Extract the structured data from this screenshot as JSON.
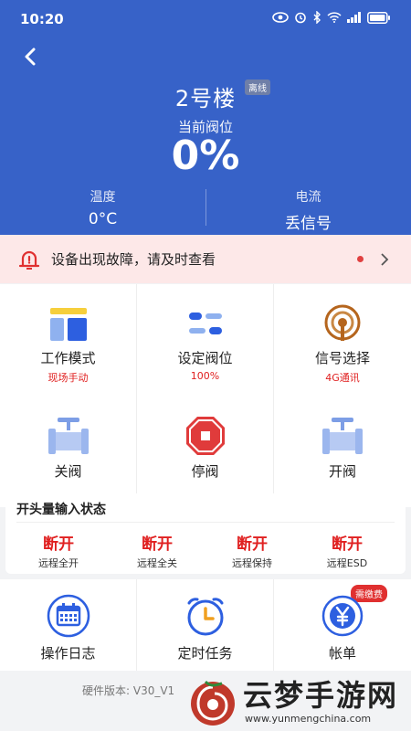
{
  "status": {
    "time": "10:20"
  },
  "header": {
    "title": "2号楼",
    "badge": "离线",
    "valve_label": "当前阀位",
    "valve_value": "0%",
    "temp_label": "温度",
    "temp_value": "0°C",
    "current_label": "电流",
    "current_value": "丢信号"
  },
  "alert": {
    "text": "设备出现故障，请及时查看"
  },
  "controls": [
    {
      "label": "工作模式",
      "sub": "现场手动",
      "icon": "mode-icon"
    },
    {
      "label": "设定阀位",
      "sub": "100%",
      "icon": "slider-icon"
    },
    {
      "label": "信号选择",
      "sub": "4G通讯",
      "icon": "signal-icon"
    }
  ],
  "actions": [
    {
      "label": "关阀",
      "icon": "valve-close-icon"
    },
    {
      "label": "停阀",
      "icon": "stop-icon"
    },
    {
      "label": "开阀",
      "icon": "valve-open-icon"
    }
  ],
  "inputs": {
    "title": "开头量输入状态",
    "items": [
      {
        "state": "断开",
        "name": "远程全开"
      },
      {
        "state": "断开",
        "name": "远程全关"
      },
      {
        "state": "断开",
        "name": "远程保持"
      },
      {
        "state": "断开",
        "name": "远程ESD"
      }
    ]
  },
  "bottom": [
    {
      "label": "操作日志",
      "icon": "calendar-icon"
    },
    {
      "label": "定时任务",
      "icon": "alarm-clock-icon"
    },
    {
      "label": "帐单",
      "icon": "yen-icon",
      "badge": "需缴费"
    }
  ],
  "footer": {
    "hardware": "硬件版本: V30_V1"
  },
  "watermark": {
    "text": "云梦手游网",
    "url": "www.yunmengchina.com"
  },
  "colors": {
    "primary": "#3762c8",
    "alert_bg": "#fde8e8",
    "danger": "#e02020"
  }
}
